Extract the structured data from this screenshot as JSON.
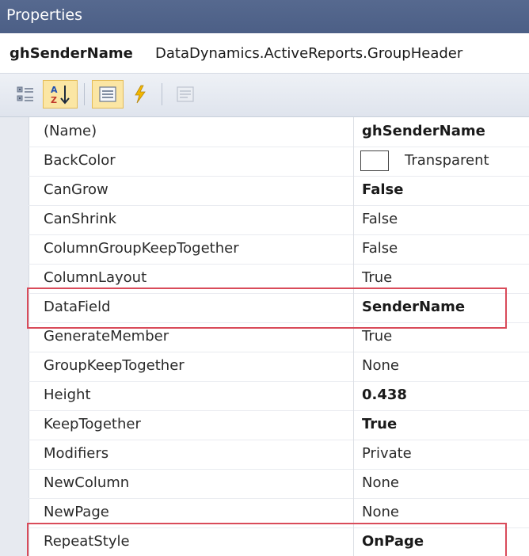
{
  "window": {
    "title": "Properties"
  },
  "object_selector": {
    "name": "ghSenderName",
    "type": "DataDynamics.ActiveReports.GroupHeader"
  },
  "toolbar": {
    "buttons": [
      {
        "name": "categorized-button",
        "icon": "categorized-icon",
        "checked": false
      },
      {
        "name": "alphabetical-button",
        "icon": "sort-az-icon",
        "checked": true
      },
      {
        "name": "properties-button",
        "icon": "properties-list-icon",
        "checked": true
      },
      {
        "name": "events-button",
        "icon": "lightning-icon",
        "checked": false
      },
      {
        "name": "property-pages-button",
        "icon": "property-pages-icon",
        "checked": false,
        "disabled": true
      }
    ]
  },
  "properties": [
    {
      "name": "(Name)",
      "value": "ghSenderName",
      "bold": true
    },
    {
      "name": "BackColor",
      "value": "Transparent",
      "bold": false,
      "swatch": true
    },
    {
      "name": "CanGrow",
      "value": "False",
      "bold": true
    },
    {
      "name": "CanShrink",
      "value": "False",
      "bold": false
    },
    {
      "name": "ColumnGroupKeepTogether",
      "value": "False",
      "bold": false
    },
    {
      "name": "ColumnLayout",
      "value": "True",
      "bold": false
    },
    {
      "name": "DataField",
      "value": "SenderName",
      "bold": true,
      "highlighted": true
    },
    {
      "name": "GenerateMember",
      "value": "True",
      "bold": false
    },
    {
      "name": "GroupKeepTogether",
      "value": "None",
      "bold": false
    },
    {
      "name": "Height",
      "value": "0.438",
      "bold": true
    },
    {
      "name": "KeepTogether",
      "value": "True",
      "bold": true
    },
    {
      "name": "Modifiers",
      "value": "Private",
      "bold": false
    },
    {
      "name": "NewColumn",
      "value": "None",
      "bold": false
    },
    {
      "name": "NewPage",
      "value": "None",
      "bold": false
    },
    {
      "name": "RepeatStyle",
      "value": "OnPage",
      "bold": true,
      "highlighted": true
    }
  ],
  "colors": {
    "titlebar": "#4f6289",
    "highlight_border": "#d94b5a",
    "checked_button": "#fbe6a4"
  }
}
